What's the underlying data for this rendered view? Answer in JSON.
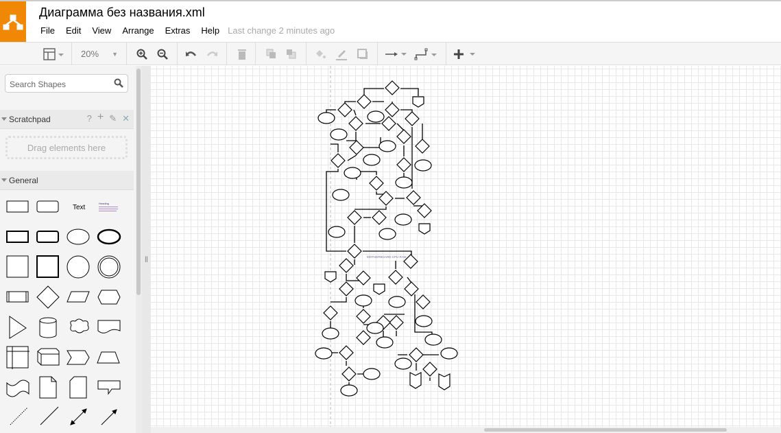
{
  "app": {
    "title": "Диаграмма без названия.xml",
    "brand_color": "#f08705"
  },
  "menu": {
    "items": [
      "File",
      "Edit",
      "View",
      "Arrange",
      "Extras",
      "Help"
    ],
    "status": "Last change 2 minutes ago"
  },
  "toolbar": {
    "zoom": "20%",
    "icons": [
      "format-panel-icon",
      "zoom-in-icon",
      "zoom-out-icon",
      "undo-icon",
      "redo-icon",
      "delete-icon",
      "to-front-icon",
      "to-back-icon",
      "fill-color-icon",
      "line-color-icon",
      "shadow-icon",
      "connection-icon",
      "waypoints-icon",
      "insert-icon"
    ]
  },
  "sidebar": {
    "search_placeholder": "Search Shapes",
    "scratchpad": {
      "title": "Scratchpad",
      "help": "?",
      "drop_hint": "Drag elements here"
    },
    "general": {
      "title": "General",
      "text_shape": "Text",
      "heading_shape": "Heading"
    }
  },
  "canvas": {
    "label": "MOTHERBOARD CPU RAM"
  }
}
